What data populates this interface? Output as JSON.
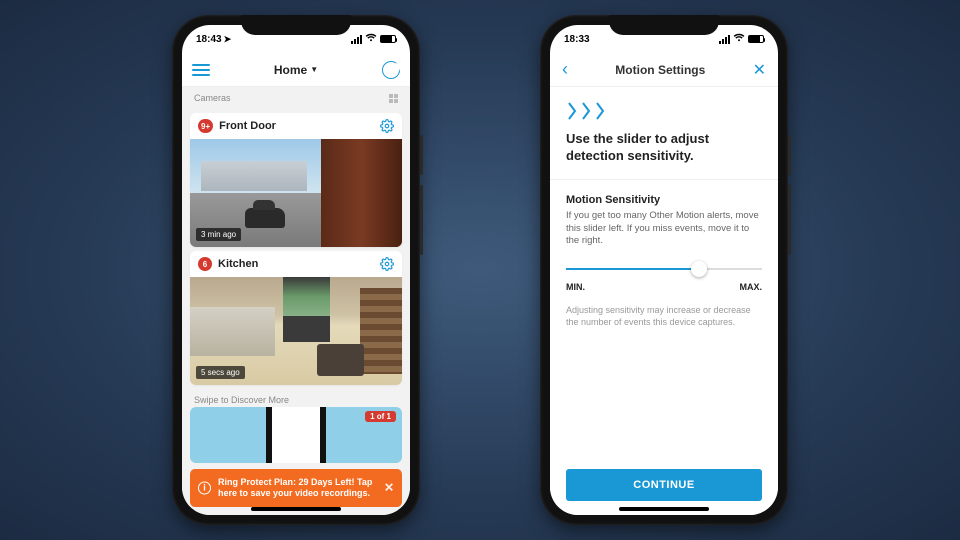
{
  "phone1": {
    "status_time": "18:43",
    "header_title": "Home",
    "section_label": "Cameras",
    "cameras": [
      {
        "badge": "9+",
        "name": "Front Door",
        "timestamp": "3 min ago"
      },
      {
        "badge": "6",
        "name": "Kitchen",
        "timestamp": "5 secs ago"
      }
    ],
    "discover_label": "Swipe to Discover More",
    "promo_pill": "1 of 1",
    "banner_text": "Ring Protect Plan: 29 Days Left! Tap here to save your video recordings."
  },
  "phone2": {
    "status_time": "18:33",
    "nav_title": "Motion Settings",
    "heading": "Use the slider to adjust detection sensitivity.",
    "section_label": "Motion Sensitivity",
    "section_desc": "If you get too many Other Motion alerts, move this slider left. If you miss events, move it to the right.",
    "min_label": "MIN.",
    "max_label": "MAX.",
    "slider_percent": 68,
    "footnote": "Adjusting sensitivity may increase or decrease the number of events this device captures.",
    "continue_label": "CONTINUE"
  }
}
